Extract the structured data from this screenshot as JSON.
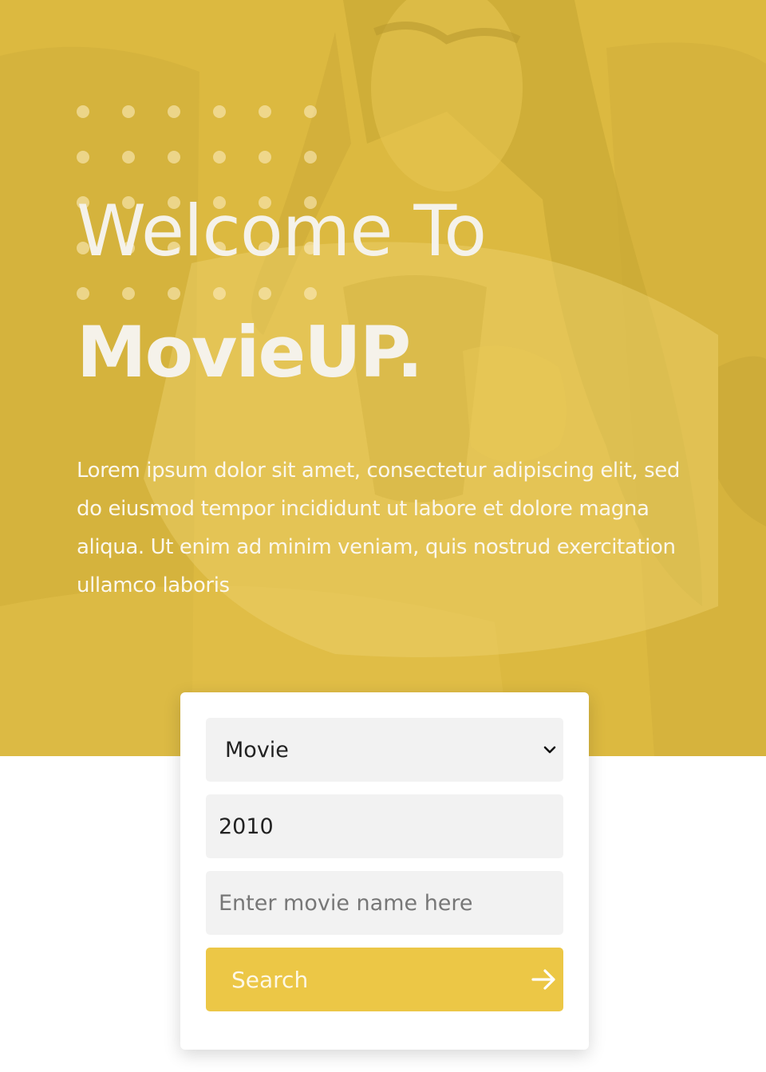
{
  "hero": {
    "title_line1": "Welcome To",
    "title_line2": "MovieUP.",
    "intro": "Lorem ipsum dolor sit amet, consectetur adipiscing elit, sed do eiusmod tempor incididunt ut labore et dolore magna aliqua. Ut enim ad minim veniam, quis nostrud exercitation ullamco laboris",
    "overlay_color": "#dcb940"
  },
  "search": {
    "type_selected": "Movie",
    "year_value": "2010",
    "name_placeholder": "Enter movie name here",
    "button_label": "Search",
    "button_icon": "arrow-right-icon",
    "button_color": "#ecc746"
  }
}
